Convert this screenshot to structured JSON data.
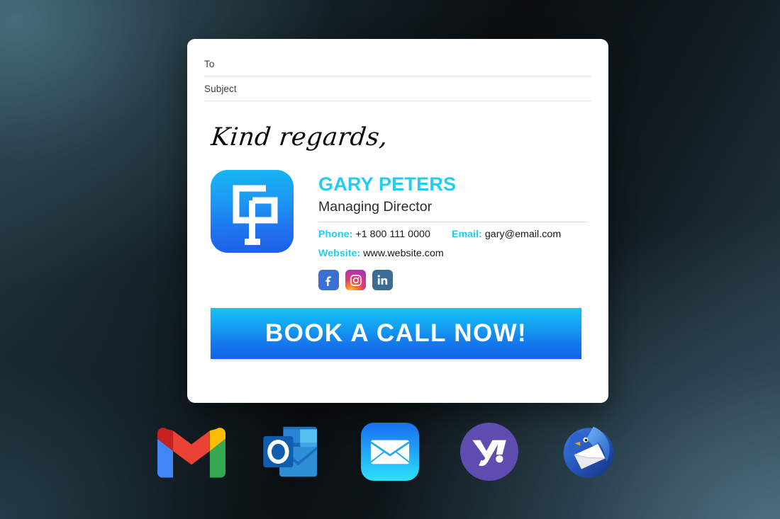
{
  "background": {
    "accent_dark": "#0a0e11",
    "accent_teal": "#2b424e"
  },
  "email_card": {
    "fields": [
      {
        "name": "to",
        "label": "To",
        "value": ""
      },
      {
        "name": "subject",
        "label": "Subject",
        "value": ""
      }
    ],
    "signoff": "Kind regards,",
    "signature": {
      "logo": {
        "icon": "gp-monogram-logo",
        "gradient_from": "#16b6f5",
        "gradient_to": "#1e5fe8"
      },
      "name": "GARY PETERS",
      "title": "Managing Director",
      "accent_color": "#23cdf2",
      "contact": {
        "phone_label": "Phone:",
        "phone_value": "+1 800 111 0000",
        "email_label": "Email:",
        "email_value": "gary@email.com",
        "website_label": "Website:",
        "website_value": "www.website.com"
      },
      "social": [
        {
          "name": "facebook",
          "icon": "facebook-icon",
          "color": "#3b6fd4"
        },
        {
          "name": "instagram",
          "icon": "instagram-icon",
          "color": "#c5349c"
        },
        {
          "name": "linkedin",
          "icon": "linkedin-icon",
          "color": "#3b6c96"
        }
      ]
    },
    "cta": {
      "label": "BOOK A CALL NOW!",
      "gradient_from": "#17c2f6",
      "gradient_to": "#1563e3"
    }
  },
  "dock": {
    "apps": [
      {
        "name": "gmail",
        "icon": "gmail-icon",
        "label": "Gmail"
      },
      {
        "name": "outlook",
        "icon": "outlook-icon",
        "label": "Outlook"
      },
      {
        "name": "apple-mail",
        "icon": "apple-mail-icon",
        "label": "Mail"
      },
      {
        "name": "yahoo-mail",
        "icon": "yahoo-mail-icon",
        "label": "Yahoo Mail"
      },
      {
        "name": "thunderbird",
        "icon": "thunderbird-icon",
        "label": "Thunderbird"
      }
    ]
  }
}
